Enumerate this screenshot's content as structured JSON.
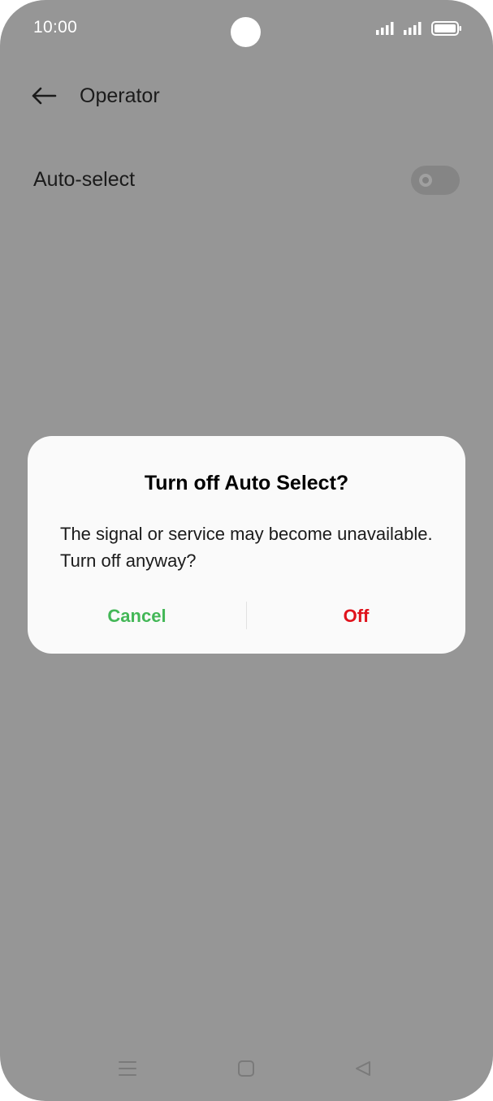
{
  "status_bar": {
    "time": "10:00",
    "icons": [
      "signal-icon",
      "signal-icon",
      "battery-icon"
    ]
  },
  "app_bar": {
    "back_icon": "arrow-left-icon",
    "title": "Operator"
  },
  "settings": {
    "auto_select": {
      "label": "Auto-select",
      "enabled": false
    }
  },
  "dialog": {
    "title": "Turn off Auto Select?",
    "message": "The signal or service may become unavailable. Turn off anyway?",
    "cancel_label": "Cancel",
    "off_label": "Off"
  },
  "nav_bar": {
    "icons": [
      "menu-icon",
      "home-icon",
      "back-triangle-icon"
    ]
  },
  "colors": {
    "scrim": "#969696",
    "dialog_bg": "#fafafa",
    "cancel": "#43b757",
    "off": "#e0131c"
  }
}
